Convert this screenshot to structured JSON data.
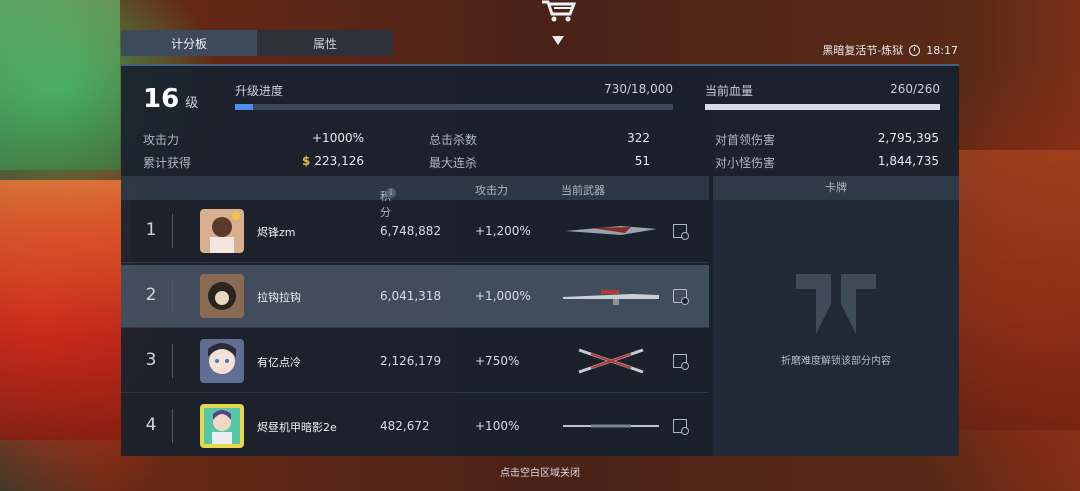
{
  "tabs": [
    {
      "label": "计分板",
      "active": true
    },
    {
      "label": "属性",
      "active": false
    }
  ],
  "event": {
    "name": "黑暗复活节-炼狱",
    "time": "18:17"
  },
  "level": {
    "number": "16",
    "unit": "级"
  },
  "progress": {
    "label": "升级进度",
    "value_text": "730/18,000",
    "fraction": 0.0406,
    "color": "#4d8ff0"
  },
  "health": {
    "label": "当前血量",
    "value_text": "260/260",
    "fraction": 1.0,
    "color": "#d6dde6"
  },
  "stats": {
    "attack": {
      "label": "攻击力",
      "value": "+1000%"
    },
    "earned": {
      "label": "累计获得",
      "value": "223,126",
      "icon": "coin-icon"
    },
    "kills": {
      "label": "总击杀数",
      "value": "322"
    },
    "streak": {
      "label": "最大连杀",
      "value": "51"
    },
    "boss_damage": {
      "label": "对首领伤害",
      "value": "2,795,395"
    },
    "minion_damage": {
      "label": "对小怪伤害",
      "value": "1,844,735"
    }
  },
  "table": {
    "headers": {
      "score": "积分",
      "attack": "攻击力",
      "weapon": "当前武器"
    },
    "rows": [
      {
        "rank": "1",
        "name": "烬锋zm",
        "score": "6,748,882",
        "attack": "+1,200%",
        "avatar_color": "#8a6a58",
        "selected": false
      },
      {
        "rank": "2",
        "name": "拉钩拉钩",
        "score": "6,041,318",
        "attack": "+1,000%",
        "avatar_color": "#3a3028",
        "selected": true
      },
      {
        "rank": "3",
        "name": "有亿点冷",
        "score": "2,126,179",
        "attack": "+750%",
        "avatar_color": "#6e7ea0",
        "selected": false
      },
      {
        "rank": "4",
        "name": "烬昼机甲暗影2e",
        "score": "482,672",
        "attack": "+100%",
        "avatar_color": "#4bb89a",
        "selected": false
      }
    ]
  },
  "cards": {
    "header": "卡牌",
    "locked_text": "折磨难度解锁该部分内容"
  },
  "footer": {
    "close_hint": "点击空白区域关闭"
  }
}
